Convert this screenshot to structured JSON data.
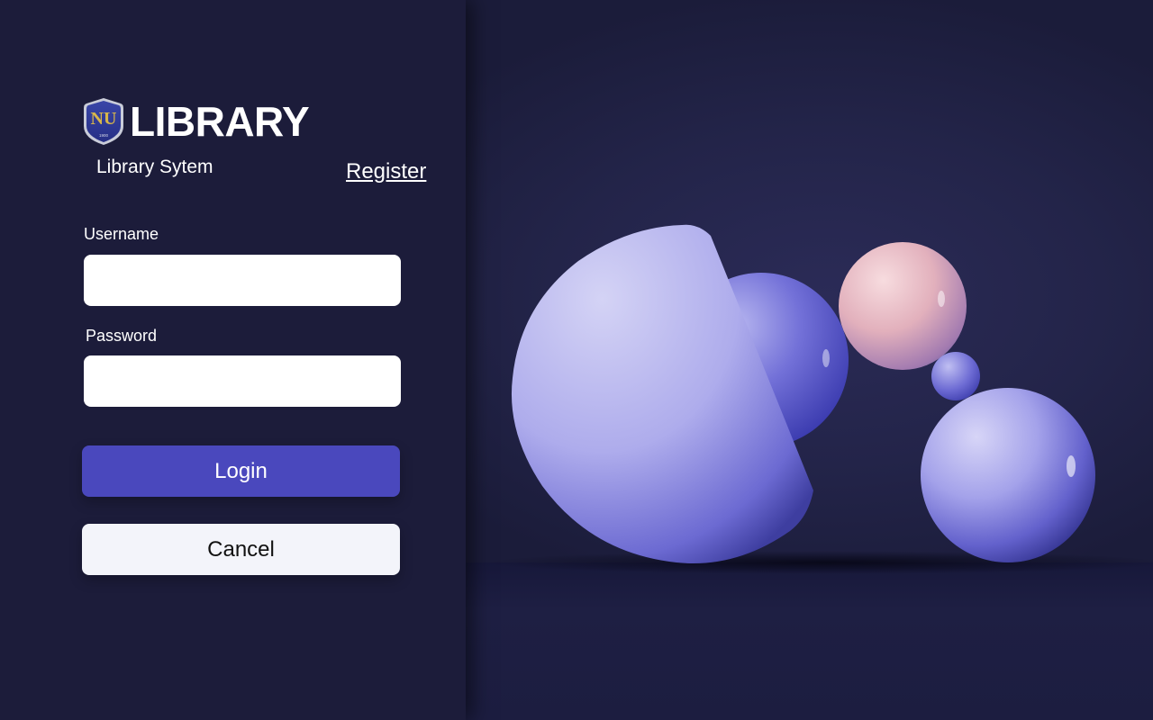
{
  "logo": {
    "crest_icon": "university-crest-icon",
    "crest_text": "NU",
    "crest_year": "1900",
    "title": "LIBRARY"
  },
  "subtitle": "Library Sytem",
  "register_link": "Register",
  "form": {
    "username_label": "Username",
    "username_value": "",
    "password_label": "Password",
    "password_value": ""
  },
  "buttons": {
    "login": "Login",
    "cancel": "Cancel"
  },
  "colors": {
    "panel_bg": "#1c1c3a",
    "accent": "#4a48bd",
    "cancel_bg": "#f3f4fa",
    "sphere_lavender": "#8f8de0",
    "sphere_pink": "#e6b4bd"
  }
}
